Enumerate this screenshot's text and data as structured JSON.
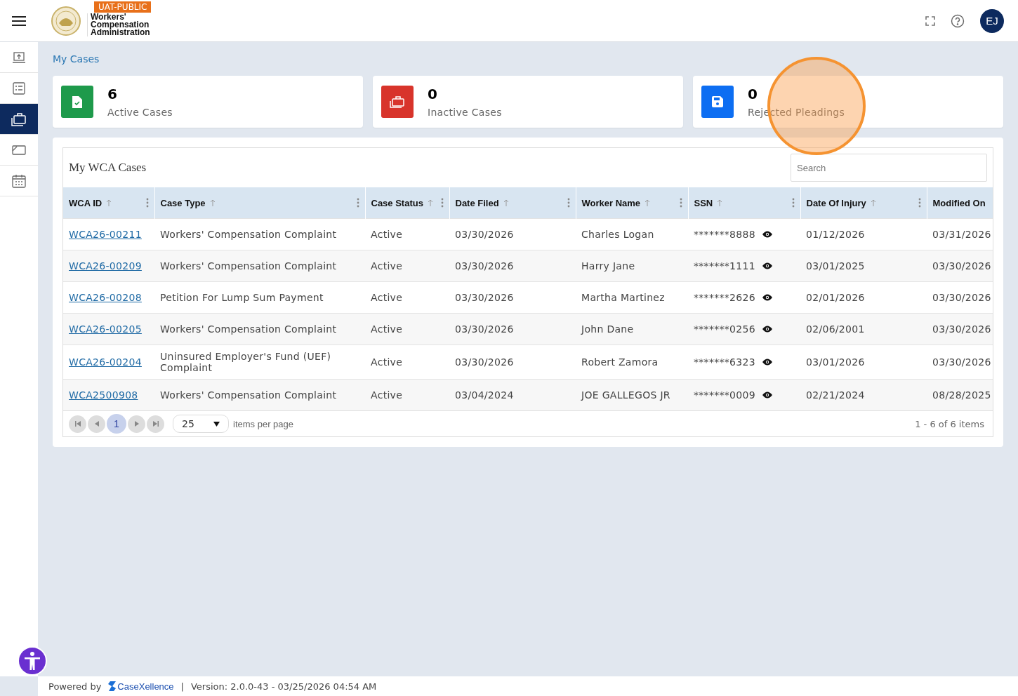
{
  "header": {
    "badge": "UAT-PUBLIC",
    "logo_lines": [
      "Workers'",
      "Compensation",
      "Administration"
    ],
    "avatar": "EJ"
  },
  "sidebar": {
    "items": [
      {
        "kind": "upload",
        "selected": false
      },
      {
        "kind": "checklist",
        "selected": false
      },
      {
        "kind": "briefcase",
        "selected": true
      },
      {
        "kind": "tablet",
        "selected": false
      },
      {
        "kind": "calendar",
        "selected": false
      }
    ]
  },
  "breadcrumb": "My Cases",
  "stats": [
    {
      "value": "6",
      "label": "Active Cases",
      "color": "#1e9a4b",
      "kind": "document"
    },
    {
      "value": "0",
      "label": "Inactive Cases",
      "color": "#d8342b",
      "kind": "briefcase"
    },
    {
      "value": "0",
      "label": "Rejected Pleadings",
      "color": "#0d6ef2",
      "kind": "save"
    }
  ],
  "table": {
    "title": "My WCA Cases",
    "search": {
      "placeholder": "Search"
    },
    "columns": [
      {
        "label": "WCA ID",
        "controls": true
      },
      {
        "label": "Case Type",
        "controls": true
      },
      {
        "label": "Case Status",
        "controls": true
      },
      {
        "label": "Date Filed",
        "controls": true
      },
      {
        "label": "Worker Name",
        "controls": true
      },
      {
        "label": "SSN",
        "controls": true
      },
      {
        "label": "Date Of Injury",
        "controls": true
      },
      {
        "label": "Modified On",
        "controls": false
      }
    ],
    "rows": [
      {
        "id": "WCA26-00211",
        "type": "Workers' Compensation Complaint",
        "status": "Active",
        "filed": "03/30/2026",
        "worker": "Charles Logan",
        "ssn": "*******8888",
        "injury": "01/12/2026",
        "modified": "03/31/2026"
      },
      {
        "id": "WCA26-00209",
        "type": "Workers' Compensation Complaint",
        "status": "Active",
        "filed": "03/30/2026",
        "worker": "Harry Jane",
        "ssn": "*******1111",
        "injury": "03/01/2025",
        "modified": "03/30/2026"
      },
      {
        "id": "WCA26-00208",
        "type": "Petition For Lump Sum Payment",
        "status": "Active",
        "filed": "03/30/2026",
        "worker": "Martha Martinez",
        "ssn": "*******2626",
        "injury": "02/01/2026",
        "modified": "03/30/2026"
      },
      {
        "id": "WCA26-00205",
        "type": "Workers' Compensation Complaint",
        "status": "Active",
        "filed": "03/30/2026",
        "worker": "John Dane",
        "ssn": "*******0256",
        "injury": "02/06/2001",
        "modified": "03/30/2026"
      },
      {
        "id": "WCA26-00204",
        "type": "Uninsured Employer's Fund (UEF) Complaint",
        "status": "Active",
        "filed": "03/30/2026",
        "worker": "Robert Zamora",
        "ssn": "*******6323",
        "injury": "03/01/2026",
        "modified": "03/30/2026"
      },
      {
        "id": "WCA2500908",
        "type": "Workers' Compensation Complaint",
        "status": "Active",
        "filed": "03/04/2024",
        "worker": "JOE GALLEGOS JR",
        "ssn": "*******0009",
        "injury": "02/21/2024",
        "modified": "08/28/2025"
      }
    ],
    "pager": {
      "pages": [
        {
          "label": "1",
          "selected": true
        }
      ],
      "page_size": "25",
      "page_size_label": "items per page",
      "summary": "1 - 6 of 6 items"
    }
  },
  "footer": {
    "powered_by": "Powered by",
    "brand": "CaseXellence",
    "separator": "|",
    "version": "Version: 2.0.0-43 - 03/25/2026 04:54 AM"
  }
}
